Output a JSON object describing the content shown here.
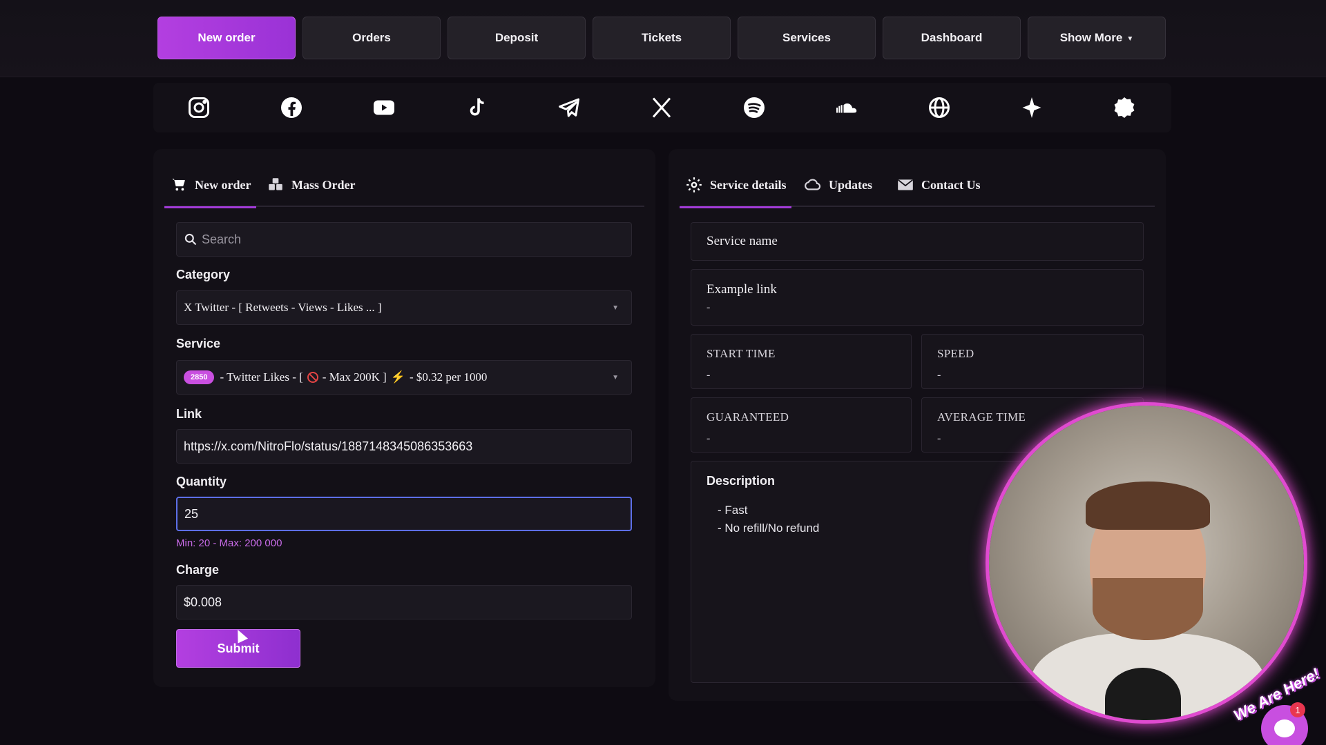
{
  "nav": {
    "items": [
      {
        "label": "New order",
        "active": true
      },
      {
        "label": "Orders"
      },
      {
        "label": "Deposit"
      },
      {
        "label": "Tickets"
      },
      {
        "label": "Services"
      },
      {
        "label": "Dashboard"
      },
      {
        "label": "Show More",
        "has_caret": true
      }
    ]
  },
  "social_icons": [
    "instagram-icon",
    "facebook-icon",
    "youtube-icon",
    "tiktok-icon",
    "telegram-icon",
    "x-twitter-icon",
    "spotify-icon",
    "soundcloud-icon",
    "globe-icon",
    "sparkle-icon",
    "badge-icon"
  ],
  "order_panel": {
    "tabs": [
      {
        "label": "New order",
        "icon": "cart-icon",
        "active": true
      },
      {
        "label": "Mass Order",
        "icon": "boxes-icon"
      }
    ],
    "search_placeholder": "Search",
    "category_label": "Category",
    "category_value": "X Twitter - [ Retweets - Views - Likes ... ]",
    "service_label": "Service",
    "service_id": "2850",
    "service_part1": "- Twitter Likes - [",
    "service_part2": "- Max 200K ]",
    "service_part3": "- $0.32 per 1000",
    "link_label": "Link",
    "link_value": "https://x.com/NitroFlo/status/1887148345086353663",
    "quantity_label": "Quantity",
    "quantity_value": "25",
    "quantity_hint": "Min: 20 - Max: 200 000",
    "charge_label": "Charge",
    "charge_value": "$0.008",
    "submit_label": "Submit"
  },
  "details_panel": {
    "tabs": [
      {
        "label": "Service details",
        "icon": "gear-icon",
        "active": true
      },
      {
        "label": "Updates",
        "icon": "cloud-icon"
      },
      {
        "label": "Contact Us",
        "icon": "mail-icon"
      }
    ],
    "service_name_label": "Service name",
    "example_link_label": "Example link",
    "example_link_value": "-",
    "start_time_label": "START TIME",
    "start_time_value": "-",
    "speed_label": "SPEED",
    "speed_value": "-",
    "guaranteed_label": "GUARANTEED",
    "guaranteed_value": "-",
    "average_time_label": "AVERAGE TIME",
    "average_time_value": "-",
    "description_label": "Description",
    "description_lines": [
      "- Fast",
      "- No refill/No refund"
    ]
  },
  "chat_widget": {
    "banner": "We Are Here!",
    "badge_count": "1"
  }
}
